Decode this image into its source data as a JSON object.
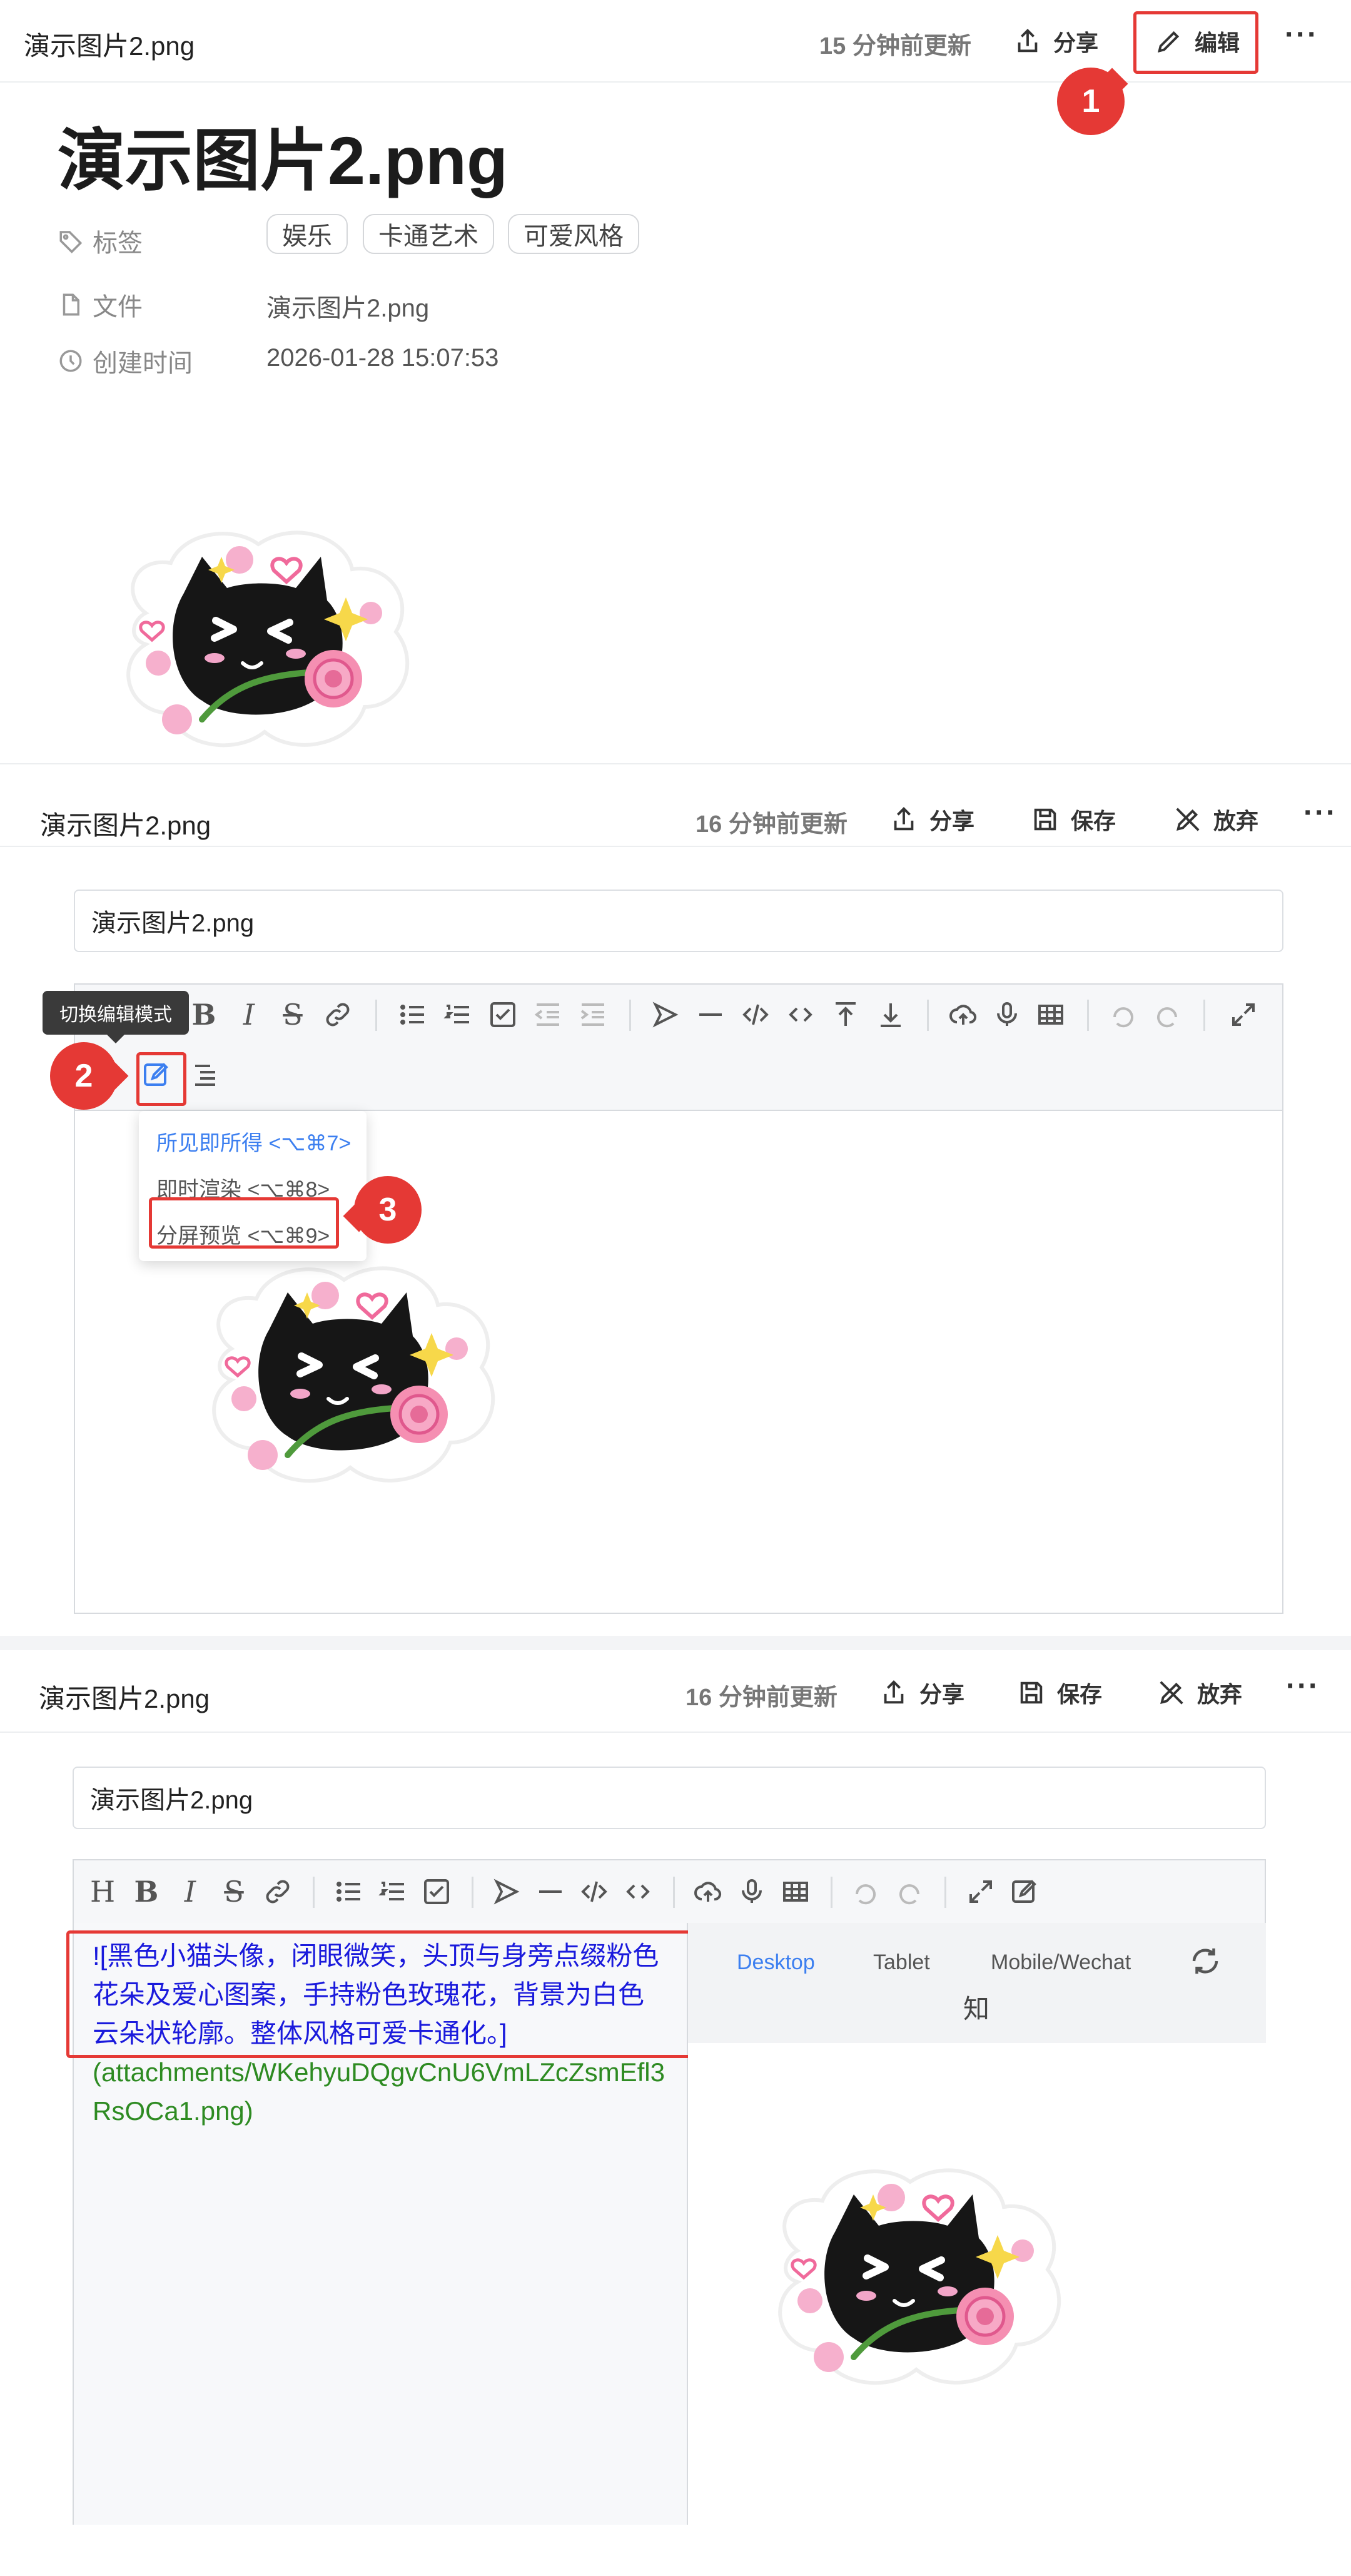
{
  "panel1": {
    "top_title": "演示图片2.png",
    "updated": "15 分钟前更新",
    "share_label": "分享",
    "edit_label": "编辑",
    "more": "···",
    "doc_title": "演示图片2.png",
    "props": {
      "tags_label": "标签",
      "tags": [
        "娱乐",
        "卡通艺术",
        "可爱风格"
      ],
      "file_label": "文件",
      "file_value": "演示图片2.png",
      "created_label": "创建时间",
      "created_value": "2026-01-28 15:07:53"
    },
    "badge": "1"
  },
  "panel2": {
    "top_title": "演示图片2.png",
    "updated": "16 分钟前更新",
    "share_label": "分享",
    "save_label": "保存",
    "discard_label": "放弃",
    "more": "···",
    "title_input": "演示图片2.png",
    "tooltip": "切换编辑模式",
    "badge_2": "2",
    "badge_3": "3",
    "mode_menu": [
      "所见即所得 <⌥⌘7>",
      "即时渲染 <⌥⌘8>",
      "分屏预览 <⌥⌘9>"
    ]
  },
  "panel3": {
    "top_title": "演示图片2.png",
    "updated": "16 分钟前更新",
    "share_label": "分享",
    "save_label": "保存",
    "discard_label": "放弃",
    "more": "···",
    "title_input": "演示图片2.png",
    "markdown_alt": "![黑色小猫头像，闭眼微笑，头顶与身旁点缀粉色花朵及爱心图案，手持粉色玫瑰花，背景为白色云朵状轮廓。整体风格可爱卡通化。]",
    "markdown_path": "(attachments/WKehyuDQgvCnU6VmLZcZsmEfl3RsOCa1.png)",
    "preview_tabs": [
      "Desktop",
      "Tablet",
      "Mobile/Wechat"
    ],
    "preview_active": "Desktop",
    "preview_extra": "知"
  },
  "colors": {
    "accent": "#3c7ff0",
    "annotation_red": "#e53935",
    "md_alt_text": "#1a1adc",
    "md_link_text": "#2e8b22"
  },
  "icons": [
    "share-icon",
    "pencil-icon",
    "save-icon",
    "discard-icon",
    "tag-icon",
    "file-icon",
    "clock-icon",
    "cat-sticker"
  ]
}
